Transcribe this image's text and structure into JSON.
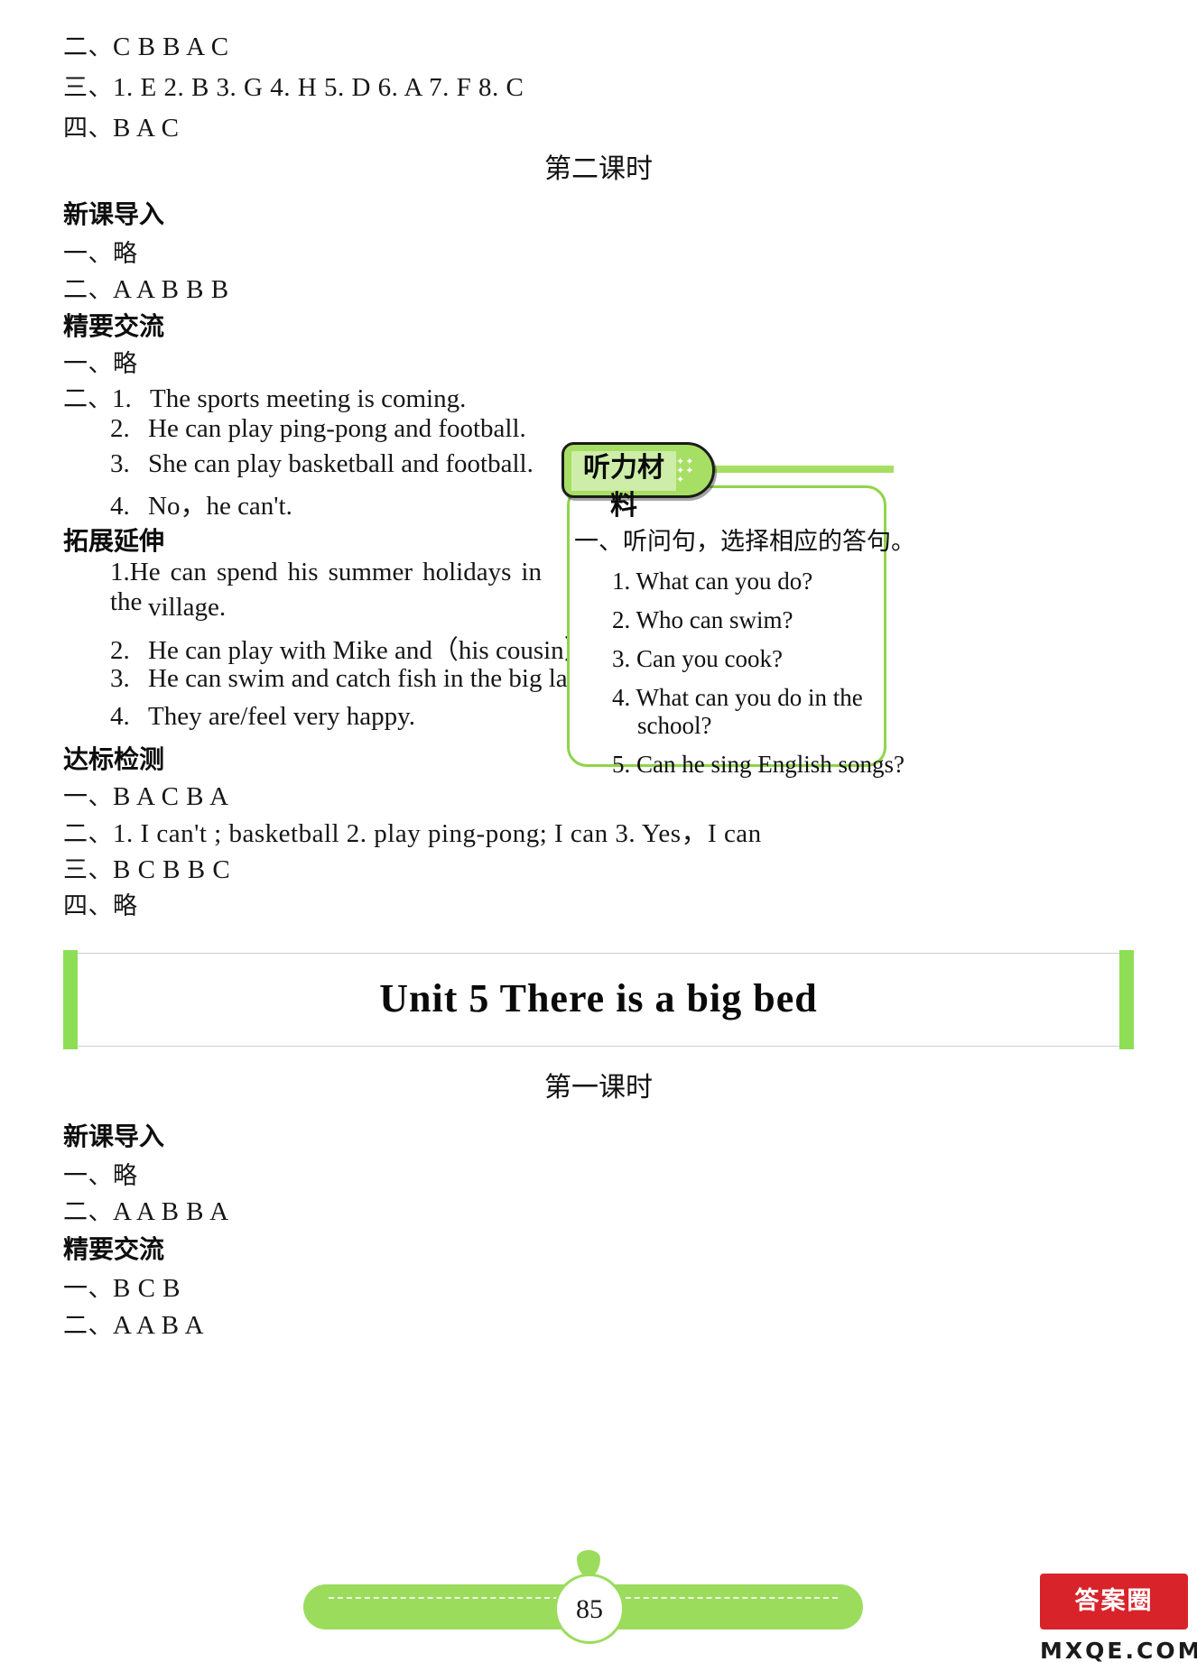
{
  "top_answers": [
    {
      "marker": "二、",
      "text": "C  B  B  A  C"
    },
    {
      "marker": "三、",
      "text": "1. E  2. B  3. G  4. H  5. D  6. A  7. F  8. C"
    },
    {
      "marker": "四、",
      "text": "B  A  C"
    }
  ],
  "lesson2": {
    "heading": "第二课时",
    "sections": [
      {
        "title": "新课导入",
        "answers": [
          {
            "marker": "一、",
            "text": "略"
          },
          {
            "marker": "二、",
            "text": "A  A  B  B  B"
          }
        ]
      },
      {
        "title": "精要交流",
        "answers": [
          {
            "marker": "一、",
            "text": "略"
          }
        ],
        "numbered_marker": "二、",
        "numbered": [
          {
            "n": "1.",
            "text": "The sports meeting is coming."
          },
          {
            "n": "2.",
            "text": "He can play ping-pong and football."
          },
          {
            "n": "3.",
            "text": "She can play basketball and football."
          },
          {
            "n": "4.",
            "text": "No，he can't."
          }
        ]
      },
      {
        "title": "拓展延伸",
        "numbered": [
          {
            "n": "1.",
            "text": "He can spend his summer holidays in the",
            "cont": "village."
          },
          {
            "n": "2.",
            "text": "He can play with Mike and（his cousin）Mary."
          },
          {
            "n": "3.",
            "text": "He can swim and catch fish in the big lake."
          },
          {
            "n": "4.",
            "text": "They are/feel very happy."
          }
        ]
      },
      {
        "title": "达标检测",
        "answers": [
          {
            "marker": "一、",
            "text": "B  A  C  B  A"
          },
          {
            "marker": "二、",
            "text": "1.  I can't ; basketball   2.  play ping-pong; I can   3.  Yes，I can"
          },
          {
            "marker": "三、",
            "text": "B  C  B  B  C"
          },
          {
            "marker": "四、",
            "text": "略"
          }
        ]
      }
    ]
  },
  "callout": {
    "tab_label": "听力材料",
    "sparkle_icon": "sparkle-icon",
    "heading": "一、听问句，选择相应的答句。",
    "items": [
      {
        "n": "1.",
        "text": "What can you do?"
      },
      {
        "n": "2.",
        "text": "Who can swim?"
      },
      {
        "n": "3.",
        "text": "Can you cook?"
      },
      {
        "n": "4.",
        "text": "What can you do in the",
        "cont": "school?"
      },
      {
        "n": "5.",
        "text": "Can he sing English songs?"
      }
    ],
    "border_color": "#8fd44a",
    "tab_color": "#a6df63"
  },
  "unit": {
    "title": "Unit 5 There is a big bed",
    "accent_color": "#8ede55"
  },
  "lesson1": {
    "heading": "第一课时",
    "sections": [
      {
        "title": "新课导入",
        "answers": [
          {
            "marker": "一、",
            "text": "略"
          },
          {
            "marker": "二、",
            "text": "A  A  B  B  A"
          }
        ]
      },
      {
        "title": "精要交流",
        "answers": [
          {
            "marker": "一、",
            "text": "B  C  B"
          },
          {
            "marker": "二、",
            "text": "A  A  B  A"
          }
        ]
      }
    ]
  },
  "footer": {
    "page_number": "85",
    "watermark_title": "答案圈",
    "watermark_sub": "MXQE.COM"
  }
}
